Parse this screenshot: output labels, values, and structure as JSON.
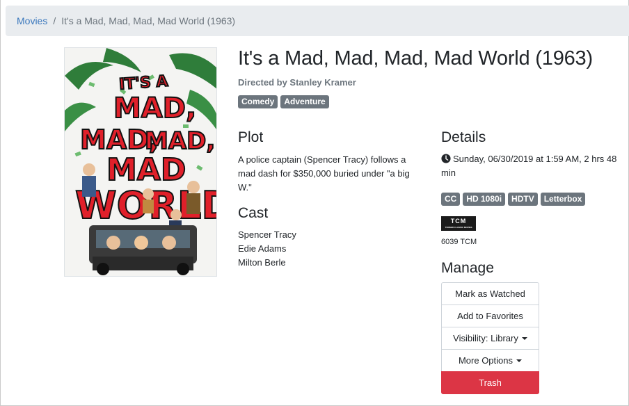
{
  "breadcrumb": {
    "root": "Movies",
    "separator": "/",
    "current": "It's a Mad, Mad, Mad, Mad World (1963)"
  },
  "movie": {
    "title": "It's a Mad, Mad, Mad, Mad World (1963)",
    "director": "Directed by Stanley Kramer",
    "genres": [
      "Comedy",
      "Adventure"
    ],
    "poster_text": "IT'S A MAD, MAD, MAD, MAD WORLD"
  },
  "plot": {
    "heading": "Plot",
    "text": "A police captain (Spencer Tracy) follows a mad dash for $350,000 buried under \"a big W.\""
  },
  "cast": {
    "heading": "Cast",
    "members": [
      "Spencer Tracy",
      "Edie Adams",
      "Milton Berle"
    ]
  },
  "details": {
    "heading": "Details",
    "airing": "Sunday, 06/30/2019 at 1:59 AM, 2 hrs 48 min",
    "tags": [
      "CC",
      "HD 1080i",
      "HDTV",
      "Letterbox"
    ],
    "network_logo_text": "TCM",
    "network_logo_subtext": "TURNER CLASSIC MOVIES",
    "channel": "6039 TCM"
  },
  "manage": {
    "heading": "Manage",
    "mark_watched": "Mark as Watched",
    "add_favorites": "Add to Favorites",
    "visibility": "Visibility: Library",
    "more_options": "More Options",
    "trash": "Trash"
  },
  "colors": {
    "badge": "#6c757d",
    "danger": "#dc3545",
    "link": "#3b78bd",
    "breadcrumb_bg": "#e9ecef"
  }
}
